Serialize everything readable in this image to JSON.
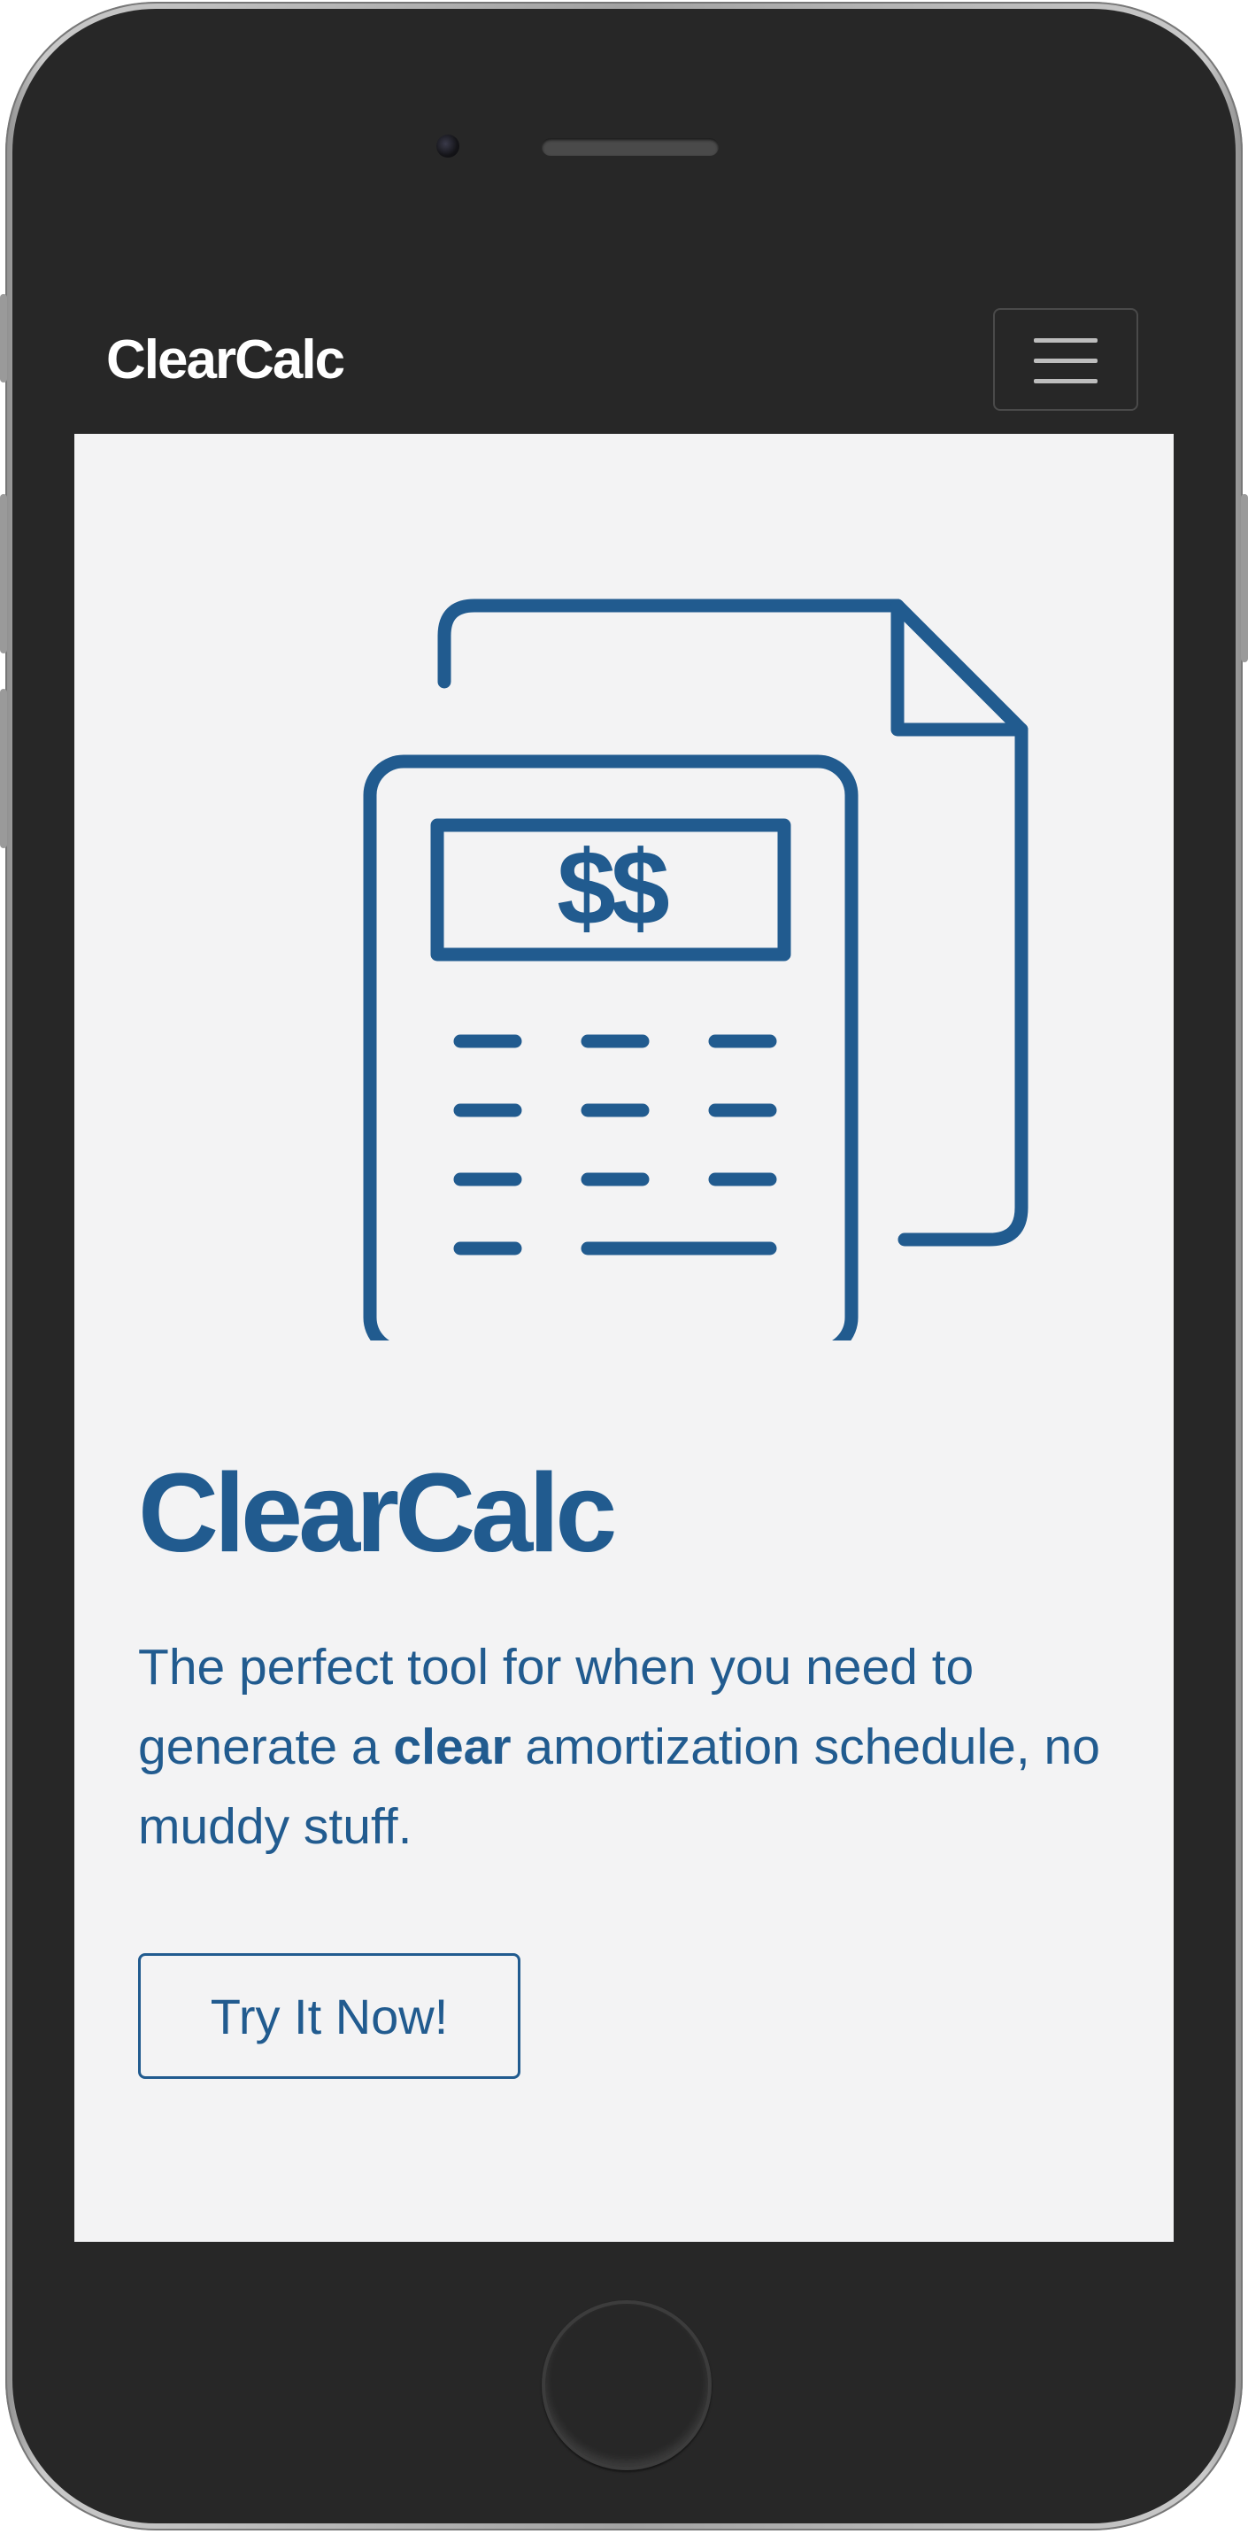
{
  "navbar": {
    "brand": "ClearCalc",
    "menu_icon": "hamburger-menu-icon"
  },
  "hero": {
    "icon": "calculator-document-icon",
    "display_text": "$$",
    "title": "ClearCalc",
    "tagline": {
      "before": "The perfect tool for when you need to generate a ",
      "emphasis": "clear",
      "after": " amortization schedule, no muddy stuff."
    },
    "cta_label": "Try It Now!"
  },
  "colors": {
    "brand_blue": "#215b8f",
    "navbar_bg": "#272727",
    "page_bg": "#f3f3f4"
  }
}
